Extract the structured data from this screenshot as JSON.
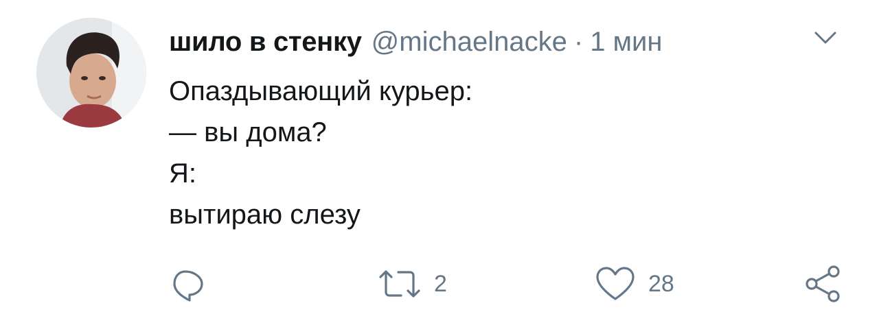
{
  "tweet": {
    "author": {
      "display_name": "шило в стенку",
      "handle": "@michaelnacke",
      "separator": "·",
      "timestamp": "1 мин"
    },
    "text_lines": [
      "Опаздывающий курьер:",
      "— вы дома?",
      "Я:",
      "вытираю слезу"
    ],
    "actions": {
      "reply": {
        "icon": "reply-icon"
      },
      "retweet": {
        "icon": "retweet-icon",
        "count": "2"
      },
      "like": {
        "icon": "heart-icon",
        "count": "28"
      },
      "share": {
        "icon": "share-icon"
      }
    },
    "menu_icon": "chevron-down-icon"
  },
  "colors": {
    "text": "#14171a",
    "secondary": "#657786",
    "background": "#ffffff"
  }
}
